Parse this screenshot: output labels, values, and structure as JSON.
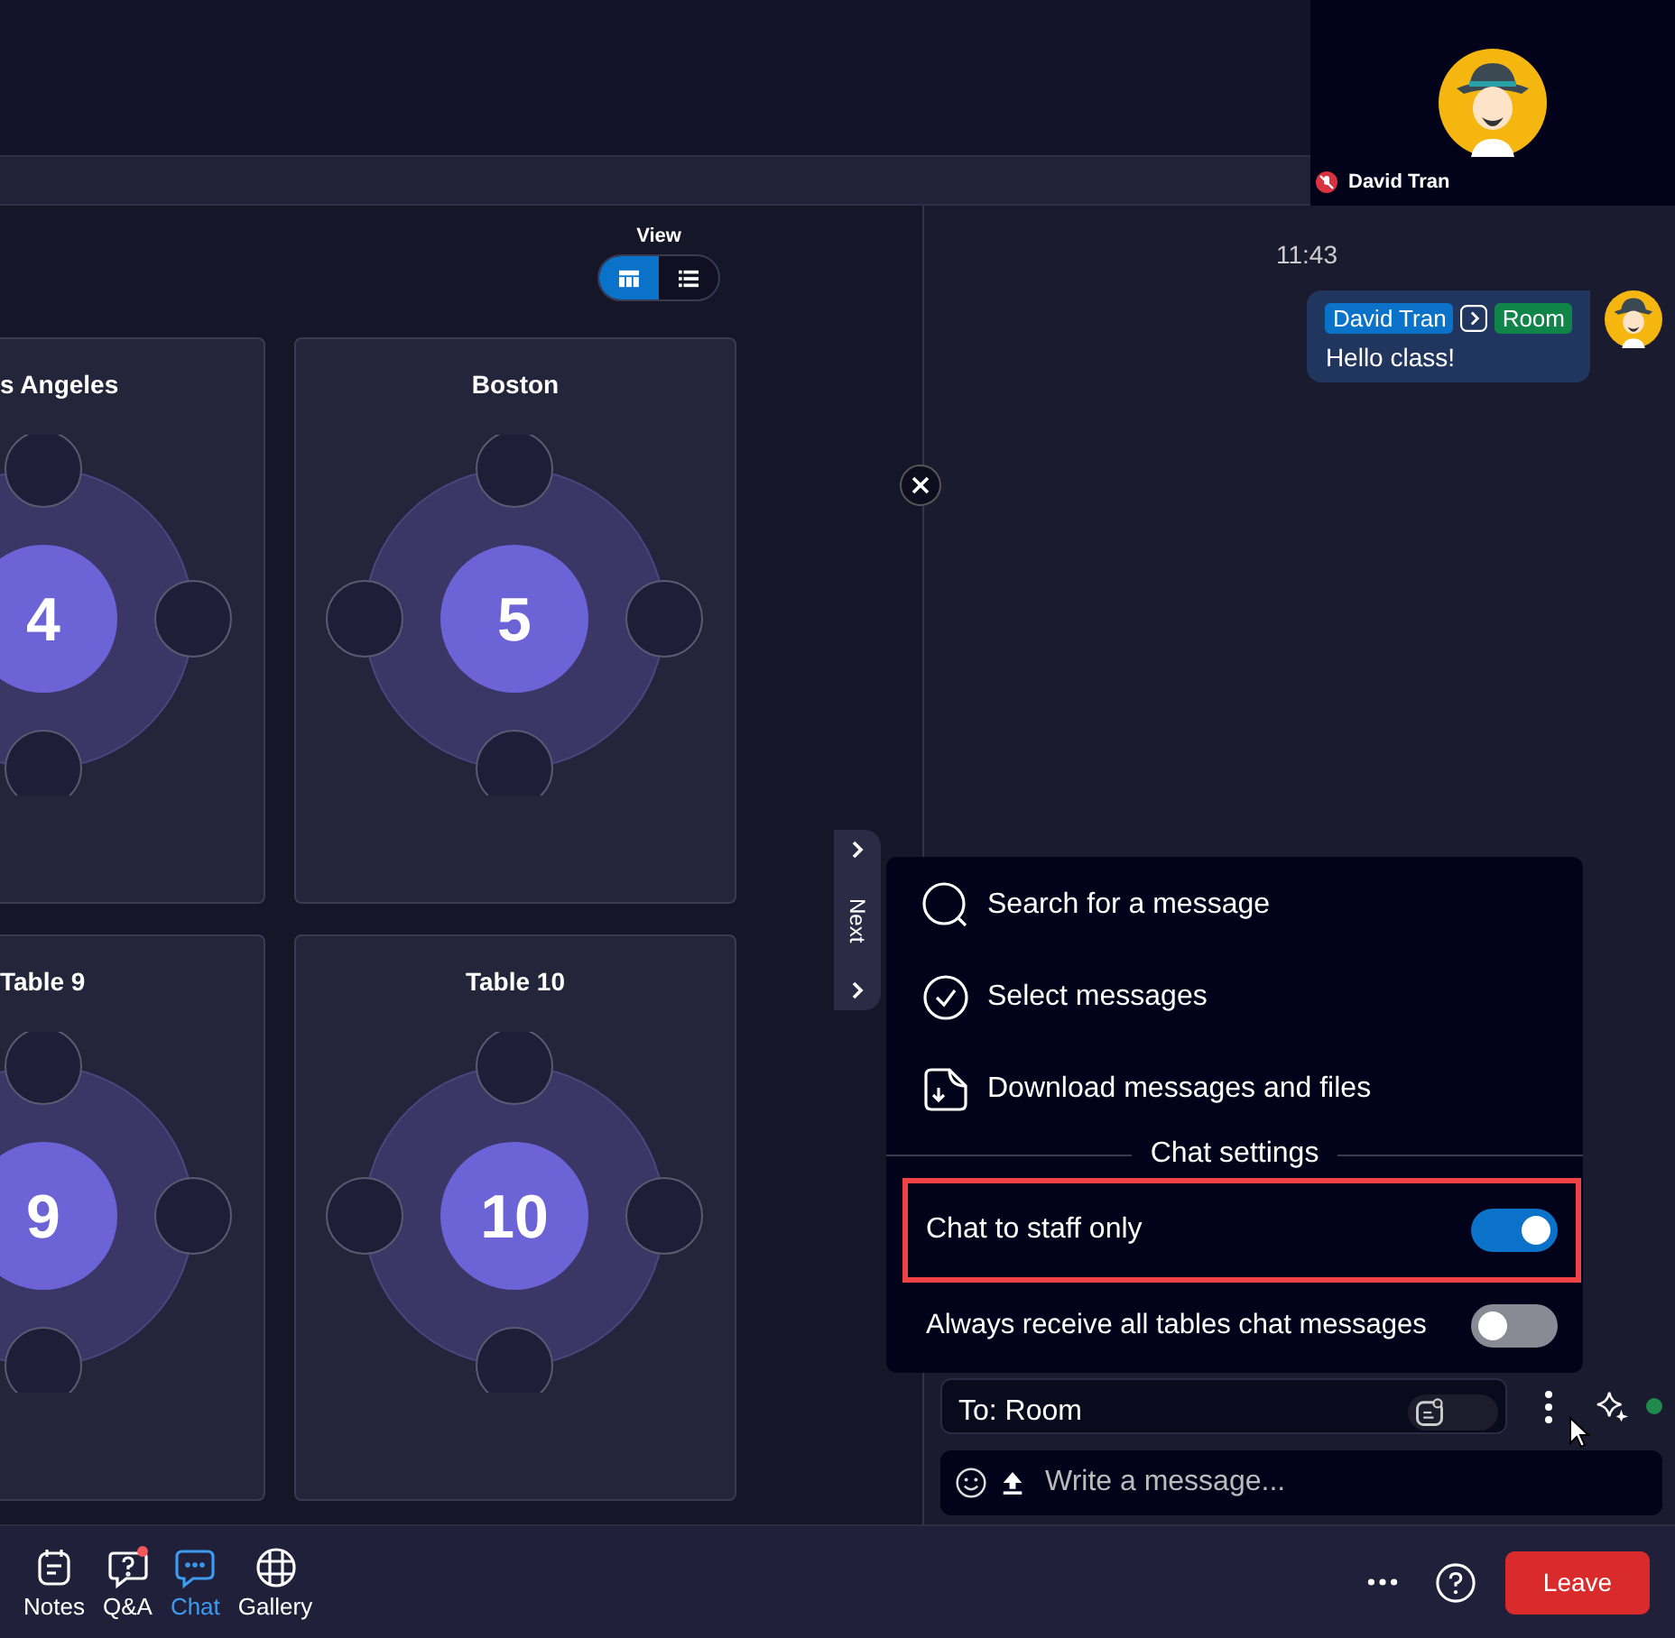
{
  "video_tile": {
    "name": "David Tran",
    "muted": true
  },
  "view_toggle": {
    "label": "View",
    "options": [
      {
        "kind": "grid",
        "selected": true
      },
      {
        "kind": "list",
        "selected": false
      }
    ]
  },
  "tables": [
    {
      "title": "s Angeles",
      "number": "4",
      "cut": true
    },
    {
      "title": "Boston",
      "number": "5",
      "cut": false
    },
    {
      "title": "Table 9",
      "number": "9",
      "cut": true
    },
    {
      "title": "Table 10",
      "number": "10",
      "cut": false
    }
  ],
  "next_tab": {
    "label": "Next"
  },
  "chat": {
    "time": "11:43",
    "messages": [
      {
        "sender": "David Tran",
        "recipient": "Room",
        "text": "Hello class!"
      }
    ]
  },
  "chat_menu": {
    "items": [
      {
        "kind": "search",
        "label": "Search for a message"
      },
      {
        "kind": "select",
        "label": "Select messages"
      },
      {
        "kind": "download",
        "label": "Download messages and files"
      }
    ],
    "section_title": "Chat settings",
    "settings": [
      {
        "label": "Chat to staff only",
        "on": true,
        "highlighted": true
      },
      {
        "label": "Always receive all tables chat messages",
        "on": false,
        "highlighted": false
      }
    ]
  },
  "composer": {
    "recipient": "To: Room",
    "private_on": false,
    "placeholder": "Write a message..."
  },
  "toolbar": {
    "items": [
      {
        "kind": "notes",
        "label": "Notes",
        "selected": false,
        "badge": false
      },
      {
        "kind": "qa",
        "label": "Q&A",
        "selected": false,
        "badge": true
      },
      {
        "kind": "chat",
        "label": "Chat",
        "selected": true,
        "badge": false
      },
      {
        "kind": "gallery",
        "label": "Gallery",
        "selected": false,
        "badge": false
      }
    ],
    "leave": "Leave"
  }
}
